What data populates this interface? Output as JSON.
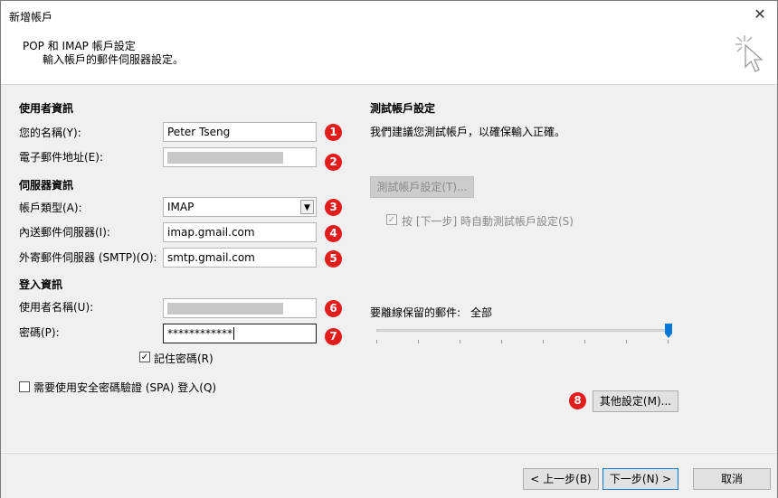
{
  "window": {
    "title": "新增帳戶",
    "close_glyph": "✕"
  },
  "header": {
    "title": "POP 和 IMAP 帳戶設定",
    "subtitle": "輸入帳戶的郵件伺服器設定。"
  },
  "left": {
    "user_info": {
      "heading": "使用者資訊",
      "name_label": "您的名稱(Y):",
      "name_value": "Peter Tseng",
      "email_label": "電子郵件地址(E):"
    },
    "server_info": {
      "heading": "伺服器資訊",
      "account_type_label": "帳戶類型(A):",
      "account_type_value": "IMAP",
      "incoming_label": "內送郵件伺服器(I):",
      "incoming_value": "imap.gmail.com",
      "outgoing_label": "外寄郵件伺服器 (SMTP)(O):",
      "outgoing_value": "smtp.gmail.com"
    },
    "login_info": {
      "heading": "登入資訊",
      "username_label": "使用者名稱(U):",
      "password_label": "密碼(P):",
      "password_value": "************",
      "remember_label": "記住密碼(R)",
      "remember_checked": "☑"
    },
    "spa_label": "需要使用安全密碼驗證 (SPA) 登入(Q)"
  },
  "right": {
    "test_heading": "測試帳戶設定",
    "test_desc": "我們建議您測試帳戶，以確保輸入正確。",
    "test_button": "測試帳戶設定(T)...",
    "auto_test_label": "按 [下一步] 時自動測試帳戶設定(S)",
    "offline_label": "要離線保留的郵件:",
    "offline_value": "全部",
    "offline_level": 1.0,
    "more_settings": "其他設定(M)..."
  },
  "badges": [
    "1",
    "2",
    "3",
    "4",
    "5",
    "6",
    "7",
    "8"
  ],
  "footer": {
    "back": "< 上一步(B)",
    "next": "下一步(N) >",
    "cancel": "取消"
  },
  "colors": {
    "badge": "#e31c1c",
    "slider_thumb": "#0078d7",
    "focus_border": "#0078d7"
  }
}
